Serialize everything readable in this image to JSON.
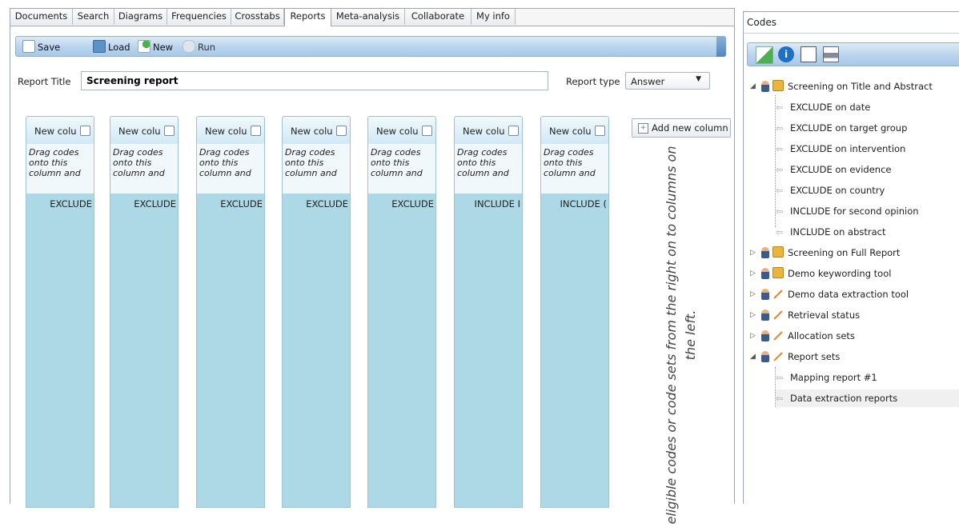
{
  "tabs": [
    "Documents",
    "Search",
    "Diagrams",
    "Frequencies",
    "Crosstabs",
    "Reports",
    "Meta-analysis",
    "Collaborate",
    "My info"
  ],
  "active_tab": "Reports",
  "toolbar": {
    "save": "Save",
    "load": "Load",
    "new": "New",
    "run": "Run"
  },
  "report": {
    "title_label": "Report Title",
    "title_value": "Screening report",
    "type_label": "Report type",
    "type_value": "Answer"
  },
  "columns": [
    {
      "header": "New colu",
      "hint": "Drag codes onto this column and",
      "code": "EXCLUDE"
    },
    {
      "header": "New colu",
      "hint": "Drag codes onto this column and",
      "code": "EXCLUDE"
    },
    {
      "header": "New colu",
      "hint": "Drag codes onto this column and",
      "code": "EXCLUDE"
    },
    {
      "header": "New colu",
      "hint": "Drag codes onto this column and",
      "code": "EXCLUDE"
    },
    {
      "header": "New colu",
      "hint": "Drag codes onto this column and",
      "code": "EXCLUDE"
    },
    {
      "header": "New colu",
      "hint": "Drag codes onto this column and",
      "code": "INCLUDE I"
    },
    {
      "header": "New colu",
      "hint": "Drag codes onto this column and",
      "code": "INCLUDE ("
    }
  ],
  "add_column_label": "Add new column",
  "drag_hint": "eligible codes or code sets from the right on to columns on the left.",
  "codes_panel": {
    "title": "Codes",
    "tree": [
      {
        "label": "Screening on Title and Abstract",
        "kind": "set",
        "lock": true,
        "expanded": true
      },
      {
        "label": "EXCLUDE on date",
        "kind": "code"
      },
      {
        "label": "EXCLUDE on target group",
        "kind": "code"
      },
      {
        "label": "EXCLUDE on intervention",
        "kind": "code"
      },
      {
        "label": "EXCLUDE on evidence",
        "kind": "code"
      },
      {
        "label": "EXCLUDE on country",
        "kind": "code"
      },
      {
        "label": "INCLUDE for second opinion",
        "kind": "code"
      },
      {
        "label": "INCLUDE on abstract",
        "kind": "code"
      },
      {
        "label": "Screening on Full Report",
        "kind": "set",
        "lock": true,
        "expanded": false
      },
      {
        "label": "Demo keywording tool",
        "kind": "set",
        "lock": true,
        "expanded": false
      },
      {
        "label": "Demo data extraction tool",
        "kind": "set",
        "lock": false,
        "expanded": false
      },
      {
        "label": "Retrieval status",
        "kind": "set",
        "lock": false,
        "expanded": false
      },
      {
        "label": "Allocation sets",
        "kind": "set",
        "lock": false,
        "expanded": false
      },
      {
        "label": "Report sets",
        "kind": "set",
        "lock": false,
        "expanded": true
      },
      {
        "label": "Mapping report #1",
        "kind": "code"
      },
      {
        "label": "Data extraction reports",
        "kind": "code",
        "highlight": true
      }
    ]
  }
}
